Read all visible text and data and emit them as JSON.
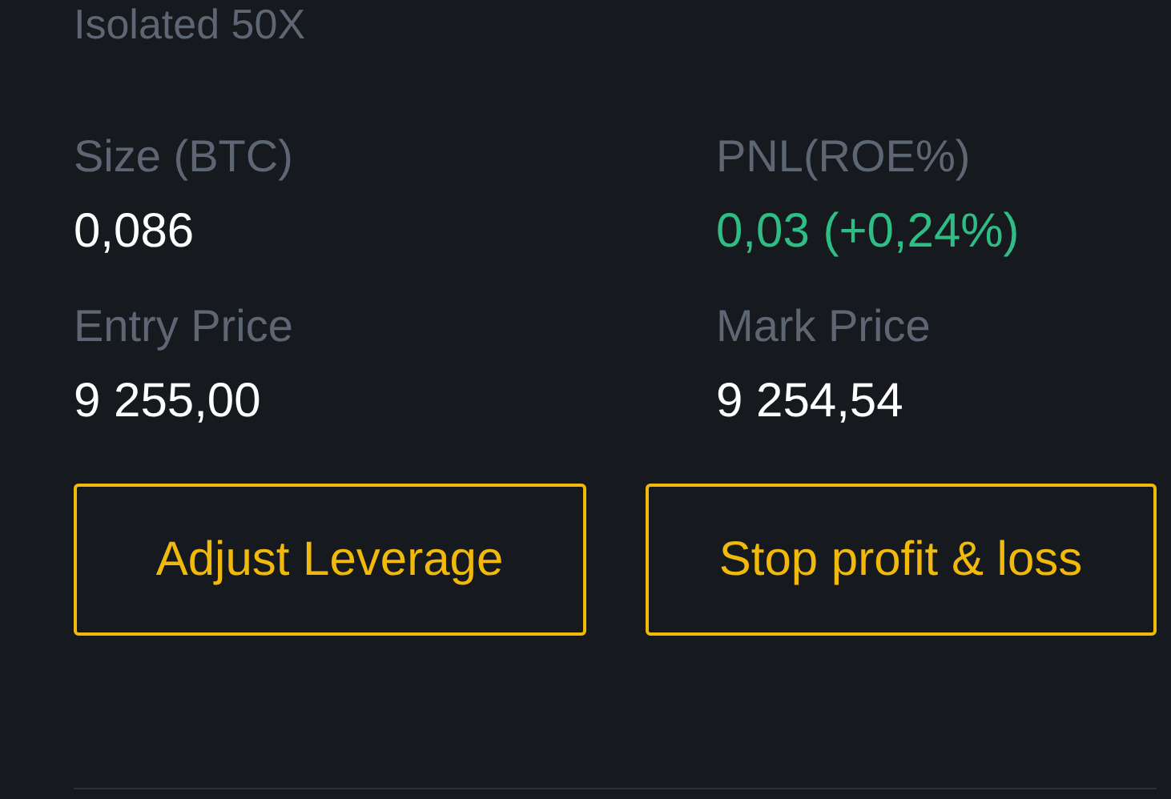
{
  "margin_mode": "Isolated 50X",
  "fields": [
    {
      "label": "Size (BTC)",
      "value": "0,086",
      "kind": "plain"
    },
    {
      "label": "PNL(ROE%)",
      "value": "0,03 (+0,24%)",
      "kind": "profit"
    },
    {
      "label": "Entry Price",
      "value": "9 255,00",
      "kind": "plain"
    },
    {
      "label": "Mark Price",
      "value": "9 254,54",
      "kind": "plain"
    }
  ],
  "buttons": [
    "Adjust Leverage",
    "Stop profit & loss"
  ]
}
